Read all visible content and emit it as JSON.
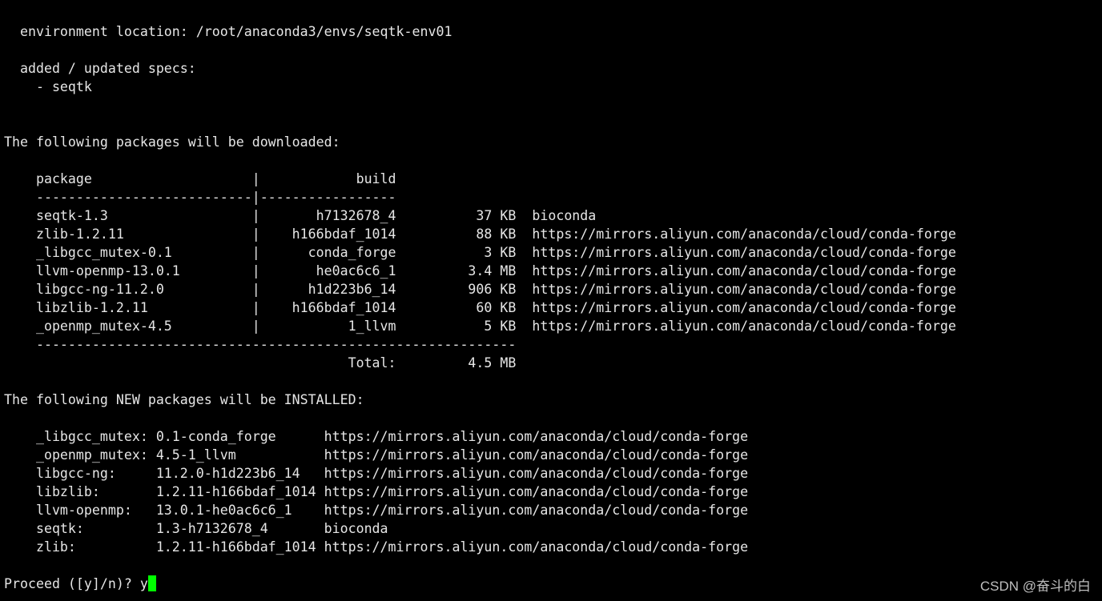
{
  "terminal": {
    "lines": [
      "  environment location: /root/anaconda3/envs/seqtk-env01",
      "",
      "  added / updated specs:",
      "    - seqtk",
      "",
      "",
      "The following packages will be downloaded:",
      "",
      "    package                    |            build",
      "    ---------------------------|-----------------",
      "    seqtk-1.3                  |       h7132678_4          37 KB  bioconda",
      "    zlib-1.2.11                |    h166bdaf_1014          88 KB  https://mirrors.aliyun.com/anaconda/cloud/conda-forge",
      "    _libgcc_mutex-0.1          |      conda_forge           3 KB  https://mirrors.aliyun.com/anaconda/cloud/conda-forge",
      "    llvm-openmp-13.0.1         |       he0ac6c6_1         3.4 MB  https://mirrors.aliyun.com/anaconda/cloud/conda-forge",
      "    libgcc-ng-11.2.0           |      h1d223b6_14         906 KB  https://mirrors.aliyun.com/anaconda/cloud/conda-forge",
      "    libzlib-1.2.11             |    h166bdaf_1014          60 KB  https://mirrors.aliyun.com/anaconda/cloud/conda-forge",
      "    _openmp_mutex-4.5          |           1_llvm           5 KB  https://mirrors.aliyun.com/anaconda/cloud/conda-forge",
      "    ------------------------------------------------------------",
      "                                           Total:         4.5 MB",
      "",
      "The following NEW packages will be INSTALLED:",
      "",
      "    _libgcc_mutex: 0.1-conda_forge      https://mirrors.aliyun.com/anaconda/cloud/conda-forge",
      "    _openmp_mutex: 4.5-1_llvm           https://mirrors.aliyun.com/anaconda/cloud/conda-forge",
      "    libgcc-ng:     11.2.0-h1d223b6_14   https://mirrors.aliyun.com/anaconda/cloud/conda-forge",
      "    libzlib:       1.2.11-h166bdaf_1014 https://mirrors.aliyun.com/anaconda/cloud/conda-forge",
      "    llvm-openmp:   13.0.1-he0ac6c6_1    https://mirrors.aliyun.com/anaconda/cloud/conda-forge",
      "    seqtk:         1.3-h7132678_4       bioconda",
      "    zlib:          1.2.11-h166bdaf_1014 https://mirrors.aliyun.com/anaconda/cloud/conda-forge",
      ""
    ],
    "prompt": {
      "text": "Proceed ([y]/n)? ",
      "input": "y"
    },
    "colors": {
      "background": "#000000",
      "text": "#e6e6e6",
      "cursor": "#00ff00"
    }
  },
  "watermark": "CSDN @奋斗的白"
}
